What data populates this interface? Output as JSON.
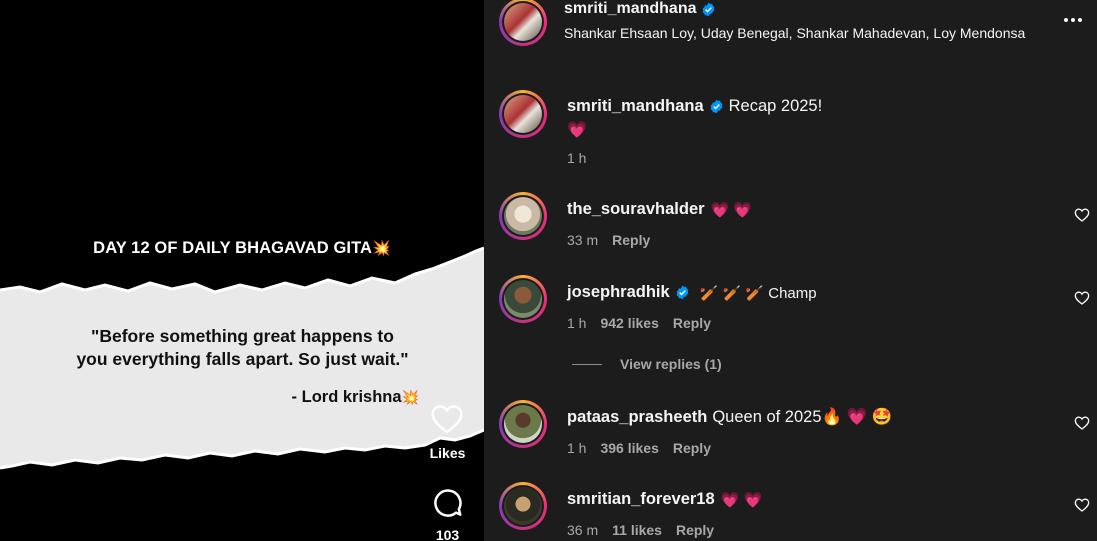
{
  "post": {
    "day_title": "DAY 12 OF DAILY BHAGAVAD GITA",
    "spark_emoji": "💥",
    "quote_line1": "\"Before something great happens to",
    "quote_line2": "you everything falls apart. So just wait.\"",
    "author": "- Lord krishna",
    "likes_label": "Likes",
    "comments_count": "103"
  },
  "header": {
    "username": "smriti_mandhana",
    "audio": "Shankar Ehsaan Loy, Uday Benegal, Shankar Mahadevan, Loy Mendonsa"
  },
  "caption": {
    "username": "smriti_mandhana",
    "text": "Recap 2025!",
    "line2": "💗",
    "time": "1 h"
  },
  "comments": [
    {
      "username": "the_souravhalder",
      "text": "💗 💗",
      "time": "33 m",
      "likes": "",
      "reply": "Reply"
    },
    {
      "username": "josephradhik",
      "text": "🏏 🏏 🏏 Champ",
      "time": "1 h",
      "likes": "942 likes",
      "reply": "Reply"
    },
    {
      "username": "pataas_prasheeth",
      "text": "Queen of 2025🔥 💗 🤩",
      "time": "1 h",
      "likes": "396 likes",
      "reply": "Reply"
    },
    {
      "username": "smritian_forever18",
      "text": "💗 💗",
      "time": "36 m",
      "likes": "11 likes",
      "reply": "Reply"
    }
  ],
  "view_replies": "View replies (1)",
  "colors": {
    "panel_bg": "#1c1c1c",
    "verified_blue": "#0095f6",
    "secondary_text": "#a8a8a8"
  }
}
